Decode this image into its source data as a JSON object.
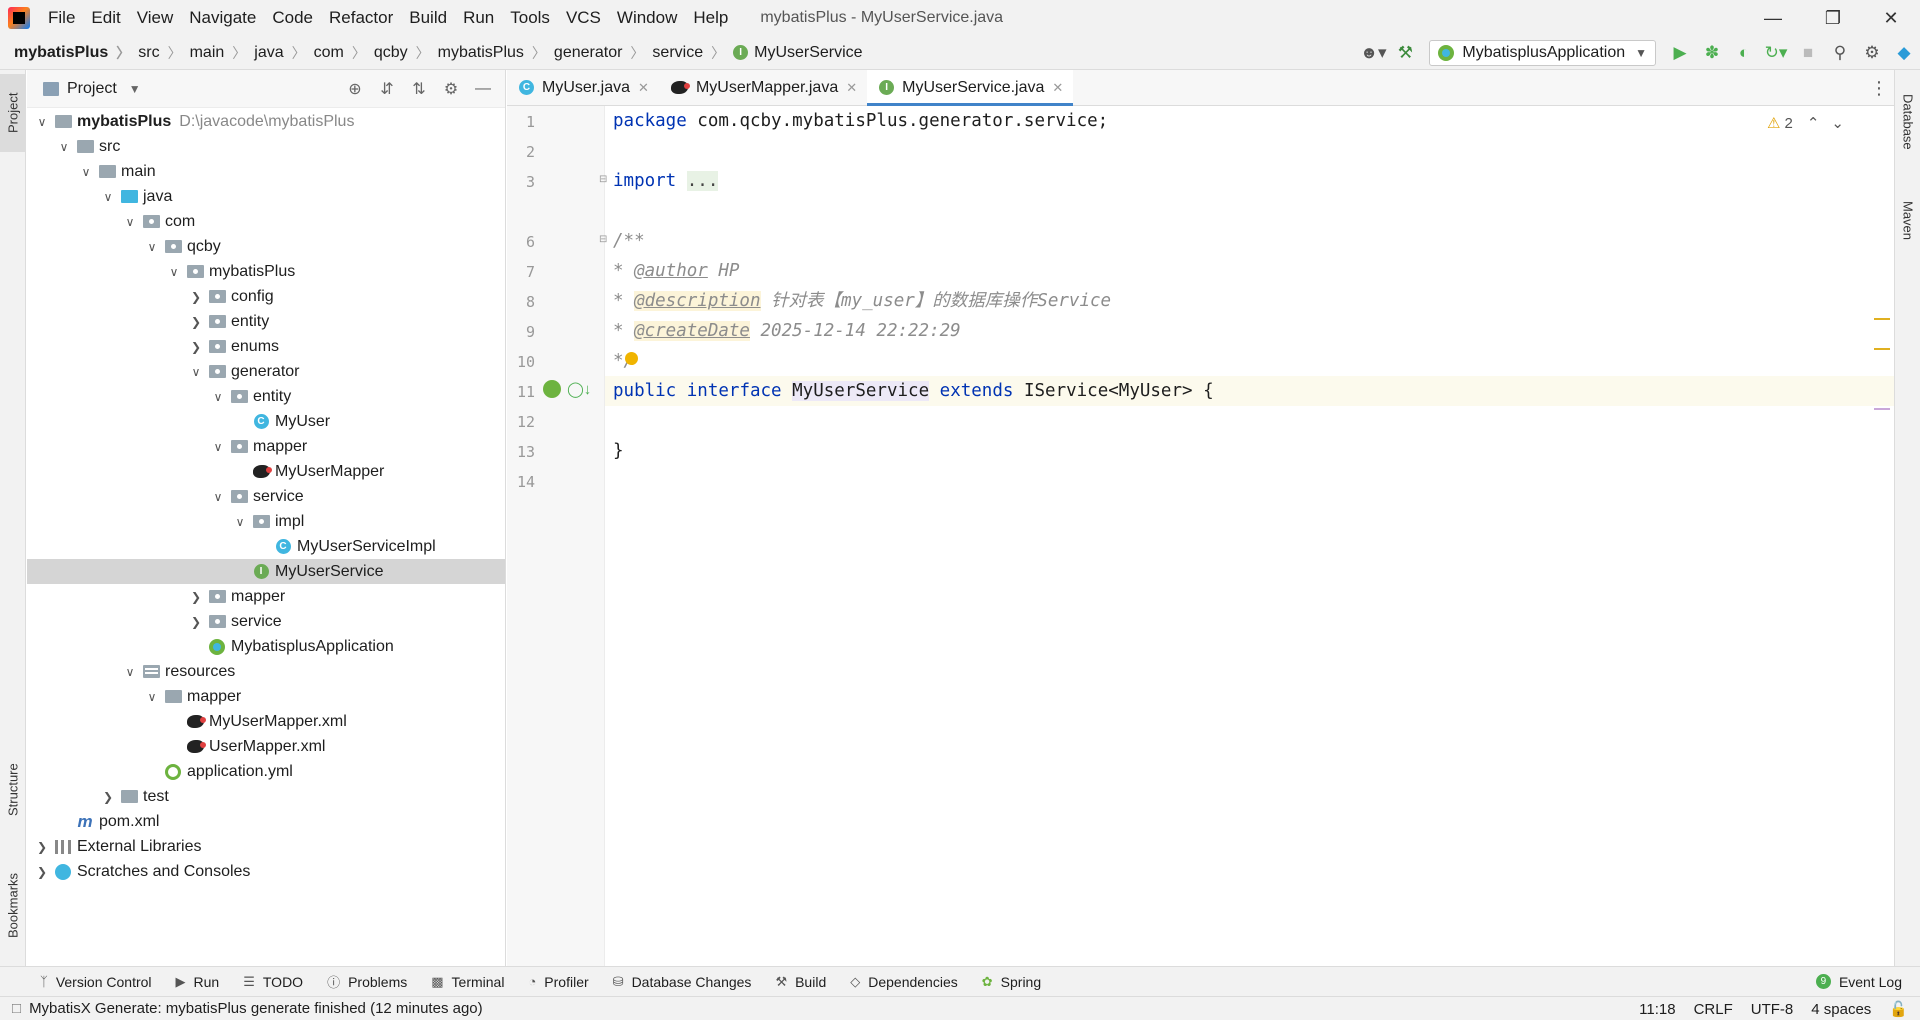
{
  "window": {
    "title": "mybatisPlus - MyUserService.java",
    "menu": [
      "File",
      "Edit",
      "View",
      "Navigate",
      "Code",
      "Refactor",
      "Build",
      "Run",
      "Tools",
      "VCS",
      "Window",
      "Help"
    ]
  },
  "breadcrumb": [
    "mybatisPlus",
    "src",
    "main",
    "java",
    "com",
    "qcby",
    "mybatisPlus",
    "generator",
    "service",
    "MyUserService"
  ],
  "toolbar": {
    "run_config": "MybatisplusApplication"
  },
  "left_stripe": [
    "Project",
    "Structure",
    "Bookmarks"
  ],
  "right_stripe": [
    "Database",
    "Maven"
  ],
  "project_panel": {
    "title": "Project",
    "tree": [
      {
        "label": "mybatisPlus",
        "path": "D:\\javacode\\mybatisPlus"
      },
      {
        "label": "src"
      },
      {
        "label": "main"
      },
      {
        "label": "java"
      },
      {
        "label": "com"
      },
      {
        "label": "qcby"
      },
      {
        "label": "mybatisPlus"
      },
      {
        "label": "config"
      },
      {
        "label": "entity"
      },
      {
        "label": "enums"
      },
      {
        "label": "generator"
      },
      {
        "label": "entity"
      },
      {
        "label": "MyUser"
      },
      {
        "label": "mapper"
      },
      {
        "label": "MyUserMapper"
      },
      {
        "label": "service"
      },
      {
        "label": "impl"
      },
      {
        "label": "MyUserServiceImpl"
      },
      {
        "label": "MyUserService"
      },
      {
        "label": "mapper"
      },
      {
        "label": "service"
      },
      {
        "label": "MybatisplusApplication"
      },
      {
        "label": "resources"
      },
      {
        "label": "mapper"
      },
      {
        "label": "MyUserMapper.xml"
      },
      {
        "label": "UserMapper.xml"
      },
      {
        "label": "application.yml"
      },
      {
        "label": "test"
      },
      {
        "label": "pom.xml"
      },
      {
        "label": "External Libraries"
      },
      {
        "label": "Scratches and Consoles"
      }
    ]
  },
  "editor_tabs": [
    "MyUser.java",
    "MyUserMapper.java",
    "MyUserService.java"
  ],
  "editor": {
    "line_numbers": [
      "1",
      "2",
      "3",
      "6",
      "7",
      "8",
      "9",
      "10",
      "11",
      "12",
      "13",
      "14"
    ],
    "code": {
      "l1_kw": "package",
      "l1_rest": " com.qcby.mybatisPlus.generator.service;",
      "l3_kw": "import",
      "l3_fold": "...",
      "l6": "/**",
      "l7_star": "* ",
      "l7_tag": "@author",
      "l7_val": " HP",
      "l8_star": "* ",
      "l8_tag": "@description",
      "l8_val": " 针对表【my_user】的数据库操作Service",
      "l9_star": "* ",
      "l9_tag": "@createDate",
      "l9_val": " 2025-12-14 22:22:29",
      "l10": "*/",
      "l11_kw1": "public",
      "l11_kw2": "interface",
      "l11_name": "MyUserService",
      "l11_kw3": "extends",
      "l11_rest": " IService<MyUser> {",
      "l13": "}"
    },
    "warning_count": "2"
  },
  "bottom_tools": [
    "Version Control",
    "Run",
    "TODO",
    "Problems",
    "Terminal",
    "Profiler",
    "Database Changes",
    "Build",
    "Dependencies",
    "Spring"
  ],
  "event_log": {
    "label": "Event Log",
    "count": "9"
  },
  "status": {
    "message": "MybatisX Generate: mybatisPlus generate finished (12 minutes ago)",
    "position": "11:18",
    "line_sep": "CRLF",
    "encoding": "UTF-8",
    "indent": "4 spaces"
  }
}
